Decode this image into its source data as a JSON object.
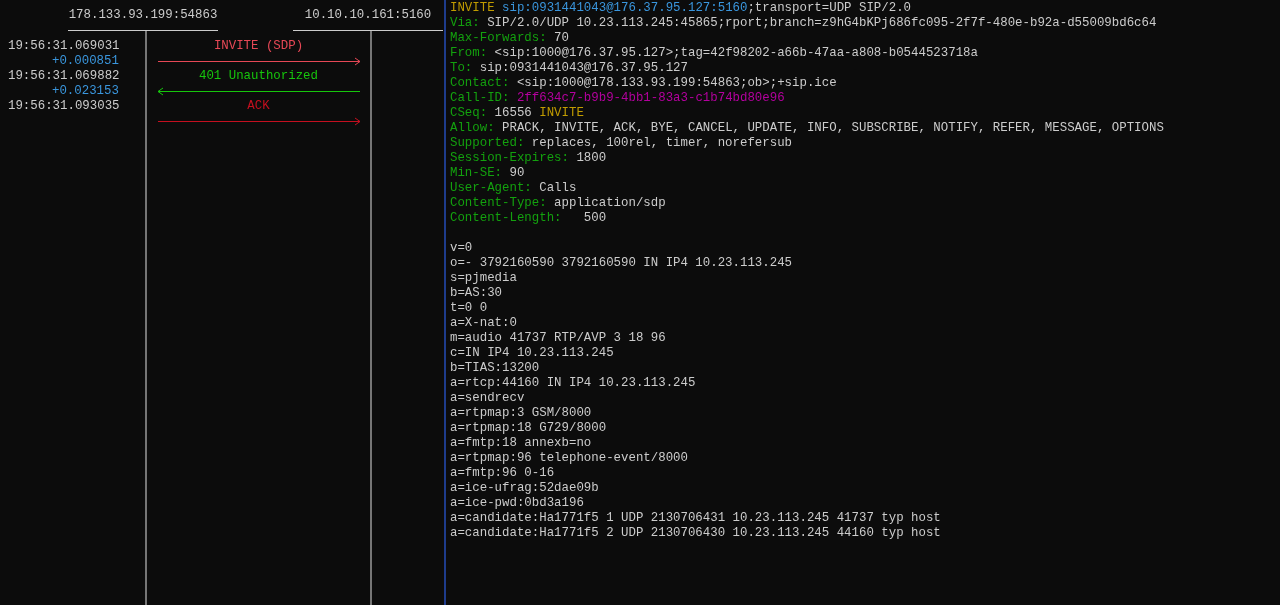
{
  "flow": {
    "endpoints": [
      {
        "address": "178.133.93.199:54863"
      },
      {
        "address": "10.10.10.161:5160"
      }
    ],
    "timeline": [
      {
        "kind": "time",
        "text": "19:56:31.069031"
      },
      {
        "kind": "delta",
        "text": "+0.000851"
      },
      {
        "kind": "time",
        "text": "19:56:31.069882"
      },
      {
        "kind": "delta",
        "text": "+0.023153"
      },
      {
        "kind": "time",
        "text": "19:56:31.093035"
      }
    ],
    "messages": [
      {
        "label": "INVITE (SDP)",
        "kind": "forward",
        "color": "#e74856"
      },
      {
        "label": "401 Unauthorized",
        "kind": "backward",
        "color": "#16c60c"
      },
      {
        "label": "ACK",
        "kind": "forward",
        "color": "#c50f1f"
      }
    ]
  },
  "detail": {
    "headers": [
      {
        "segments": [
          {
            "kind": "method",
            "text": "INVITE"
          },
          {
            "kind": "uri",
            "text": " sip:0931441043@176.37.95.127:5160"
          },
          {
            "kind": "value",
            "text": ";transport=UDP SIP/2.0"
          }
        ]
      },
      {
        "segments": [
          {
            "kind": "name",
            "text": "Via:"
          },
          {
            "kind": "value",
            "text": " SIP/2.0/UDP 10.23.113.245:45865;rport;branch=z9hG4bKPj686fc095-2f7f-480e-b92a-d55009bd6c64"
          }
        ]
      },
      {
        "segments": [
          {
            "kind": "name",
            "text": "Max-Forwards:"
          },
          {
            "kind": "value",
            "text": " 70"
          }
        ]
      },
      {
        "segments": [
          {
            "kind": "name",
            "text": "From:"
          },
          {
            "kind": "value",
            "text": " <sip:1000@176.37.95.127>;tag=42f98202-a66b-47aa-a808-b0544523718a"
          }
        ]
      },
      {
        "segments": [
          {
            "kind": "name",
            "text": "To:"
          },
          {
            "kind": "value",
            "text": " sip:0931441043@176.37.95.127"
          }
        ]
      },
      {
        "segments": [
          {
            "kind": "name",
            "text": "Contact:"
          },
          {
            "kind": "value",
            "text": " <sip:1000@178.133.93.199:54863;ob>;+sip.ice"
          }
        ]
      },
      {
        "segments": [
          {
            "kind": "name",
            "text": "Call-ID:"
          },
          {
            "kind": "callid",
            "text": " 2ff634c7-b9b9-4bb1-83a3-c1b74bd80e96"
          }
        ]
      },
      {
        "segments": [
          {
            "kind": "name",
            "text": "CSeq:"
          },
          {
            "kind": "value",
            "text": " 16556 "
          },
          {
            "kind": "method",
            "text": "INVITE"
          }
        ]
      },
      {
        "segments": [
          {
            "kind": "name",
            "text": "Allow:"
          },
          {
            "kind": "value",
            "text": " PRACK, INVITE, ACK, BYE, CANCEL, UPDATE, INFO, SUBSCRIBE, NOTIFY, REFER, MESSAGE, OPTIONS"
          }
        ]
      },
      {
        "segments": [
          {
            "kind": "name",
            "text": "Supported:"
          },
          {
            "kind": "value",
            "text": " replaces, 100rel, timer, norefersub"
          }
        ]
      },
      {
        "segments": [
          {
            "kind": "name",
            "text": "Session-Expires:"
          },
          {
            "kind": "value",
            "text": " 1800"
          }
        ]
      },
      {
        "segments": [
          {
            "kind": "name",
            "text": "Min-SE:"
          },
          {
            "kind": "value",
            "text": " 90"
          }
        ]
      },
      {
        "segments": [
          {
            "kind": "name",
            "text": "User-Agent:"
          },
          {
            "kind": "value",
            "text": " Calls"
          }
        ]
      },
      {
        "segments": [
          {
            "kind": "name",
            "text": "Content-Type:"
          },
          {
            "kind": "value",
            "text": " application/sdp"
          }
        ]
      },
      {
        "segments": [
          {
            "kind": "name",
            "text": "Content-Length:"
          },
          {
            "kind": "value",
            "text": "   500"
          }
        ]
      }
    ],
    "body": [
      "v=0",
      "o=- 3792160590 3792160590 IN IP4 10.23.113.245",
      "s=pjmedia",
      "b=AS:30",
      "t=0 0",
      "a=X-nat:0",
      "m=audio 41737 RTP/AVP 3 18 96",
      "c=IN IP4 10.23.113.245",
      "b=TIAS:13200",
      "a=rtcp:44160 IN IP4 10.23.113.245",
      "a=sendrecv",
      "a=rtpmap:3 GSM/8000",
      "a=rtpmap:18 G729/8000",
      "a=fmtp:18 annexb=no",
      "a=rtpmap:96 telephone-event/8000",
      "a=fmtp:96 0-16",
      "a=ice-ufrag:52dae09b",
      "a=ice-pwd:0bd3a196",
      "a=candidate:Ha1771f5 1 UDP 2130706431 10.23.113.245 41737 typ host",
      "a=candidate:Ha1771f5 2 UDP 2130706430 10.23.113.245 44160 typ host"
    ]
  }
}
